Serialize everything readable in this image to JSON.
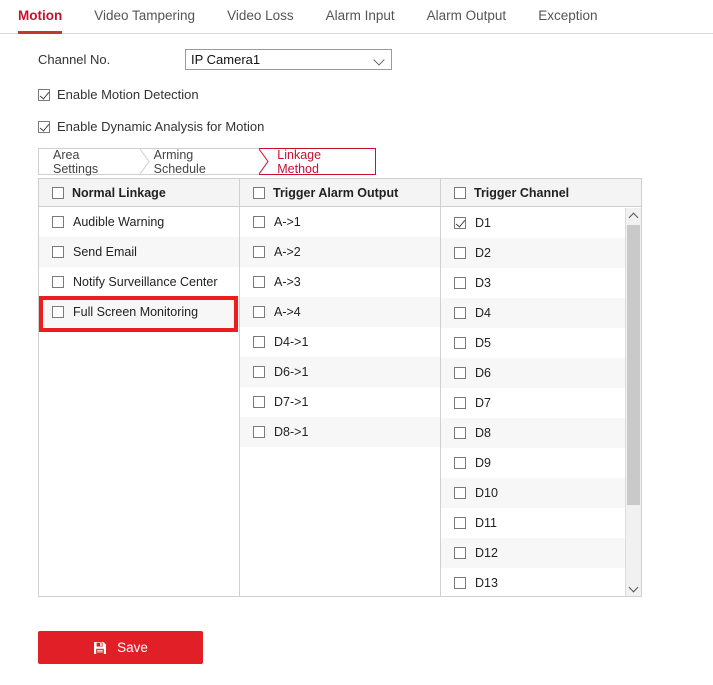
{
  "theme": {
    "accent_red": "#c8102e",
    "button_red": "#e01f26",
    "highlight_red": "#ee1c1c",
    "header_bg": "#f4f4f4",
    "alt_row_bg": "#f7f7f7"
  },
  "tabs": [
    {
      "label": "Motion",
      "active": true
    },
    {
      "label": "Video Tampering",
      "active": false
    },
    {
      "label": "Video Loss",
      "active": false
    },
    {
      "label": "Alarm Input",
      "active": false
    },
    {
      "label": "Alarm Output",
      "active": false
    },
    {
      "label": "Exception",
      "active": false
    }
  ],
  "form": {
    "channel_label": "Channel No.",
    "channel_value": "IP Camera1",
    "channel_options": [
      "IP Camera1"
    ],
    "caret_icon": "chevron-down-icon",
    "enable_motion_label": "Enable Motion Detection",
    "enable_motion_checked": true,
    "enable_dynamic_label": "Enable Dynamic Analysis for Motion",
    "enable_dynamic_checked": true
  },
  "subtabs": [
    {
      "label": "Area Settings",
      "active": false
    },
    {
      "label": "Arming Schedule",
      "active": false
    },
    {
      "label": "Linkage Method",
      "active": true
    }
  ],
  "table": {
    "columns": [
      {
        "header": "Normal Linkage",
        "header_checked": false,
        "items": [
          {
            "label": "Audible Warning",
            "checked": false
          },
          {
            "label": "Send Email",
            "checked": false
          },
          {
            "label": "Notify Surveillance Center",
            "checked": false
          },
          {
            "label": "Full Screen Monitoring",
            "checked": false,
            "highlighted": true
          }
        ]
      },
      {
        "header": "Trigger Alarm Output",
        "header_checked": false,
        "items": [
          {
            "label": "A->1",
            "checked": false
          },
          {
            "label": "A->2",
            "checked": false
          },
          {
            "label": "A->3",
            "checked": false
          },
          {
            "label": "A->4",
            "checked": false
          },
          {
            "label": "D4->1",
            "checked": false
          },
          {
            "label": "D6->1",
            "checked": false
          },
          {
            "label": "D7->1",
            "checked": false
          },
          {
            "label": "D8->1",
            "checked": false
          }
        ]
      },
      {
        "header": "Trigger Channel",
        "header_checked": false,
        "scrollable": true,
        "items": [
          {
            "label": "D1",
            "checked": true
          },
          {
            "label": "D2",
            "checked": false
          },
          {
            "label": "D3",
            "checked": false
          },
          {
            "label": "D4",
            "checked": false
          },
          {
            "label": "D5",
            "checked": false
          },
          {
            "label": "D6",
            "checked": false
          },
          {
            "label": "D7",
            "checked": false
          },
          {
            "label": "D8",
            "checked": false
          },
          {
            "label": "D9",
            "checked": false
          },
          {
            "label": "D10",
            "checked": false
          },
          {
            "label": "D11",
            "checked": false
          },
          {
            "label": "D12",
            "checked": false
          },
          {
            "label": "D13",
            "checked": false
          }
        ]
      }
    ],
    "scrollbar": {
      "up_icon": "chevron-up-icon",
      "down_icon": "chevron-down-icon"
    }
  },
  "save": {
    "label": "Save",
    "icon": "floppy-disk-icon"
  }
}
